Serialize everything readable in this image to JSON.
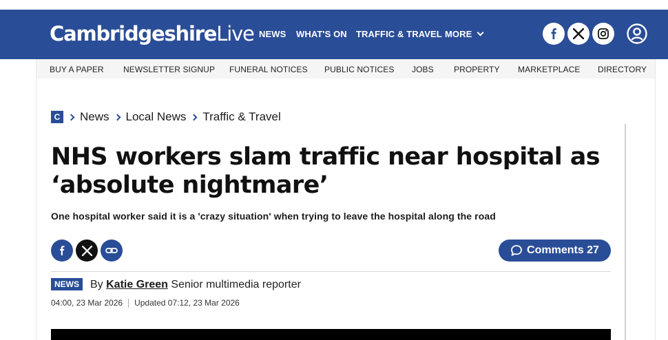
{
  "brand": {
    "name_bold": "Cambridgeshire",
    "name_light": "Live",
    "color": "#2a4d97"
  },
  "main_nav": {
    "news": "NEWS",
    "whats_on": "WHAT'S ON",
    "traffic": "TRAFFIC & TRAVEL",
    "more": "MORE"
  },
  "header_icons": [
    "facebook-icon",
    "x-icon",
    "instagram-icon",
    "account-icon"
  ],
  "sub_nav": {
    "buy_paper": "BUY A PAPER",
    "newsletter": "NEWSLETTER SIGNUP",
    "funeral": "FUNERAL NOTICES",
    "public": "PUBLIC NOTICES",
    "jobs": "JOBS",
    "property": "PROPERTY",
    "marketplace": "MARKETPLACE",
    "directory": "DIRECTORY"
  },
  "breadcrumb": {
    "logo": "C",
    "items": [
      "News",
      "Local News",
      "Traffic & Travel"
    ]
  },
  "article": {
    "headline": "NHS workers slam traffic near hospital as ‘absolute nightmare’",
    "standfirst": "One hospital worker said it is a 'crazy situation' when trying to leave the hospital along the road",
    "comments_label": "Comments 27",
    "badge": "NEWS",
    "by": "By",
    "author": "Katie Green",
    "role": "Senior multimedia reporter",
    "published": "04:00, 23 Mar 2026",
    "updated": "Updated 07:12, 23 Mar 2026"
  },
  "share_icons": [
    "facebook-icon",
    "x-icon",
    "link-icon"
  ]
}
